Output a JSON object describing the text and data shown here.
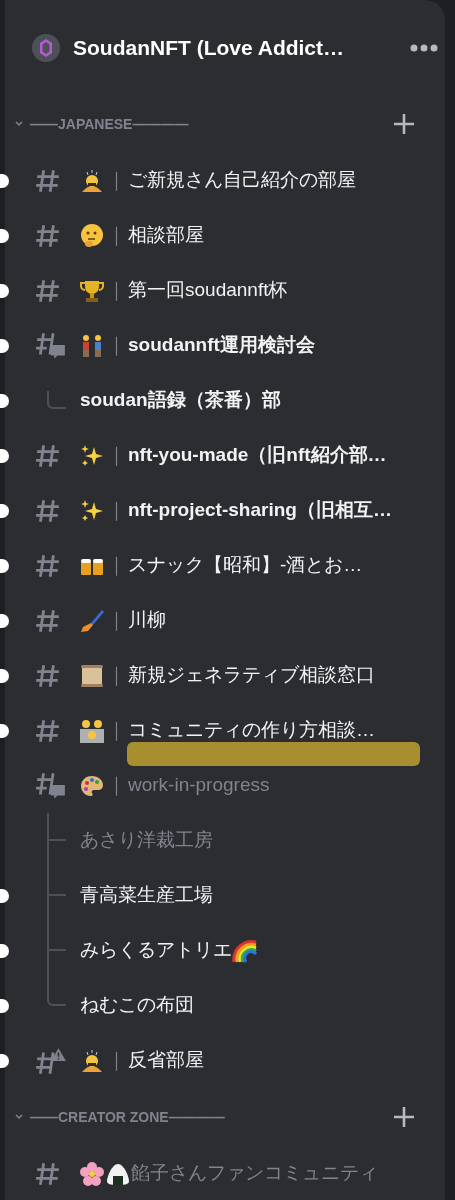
{
  "server": {
    "name": "SoudanNFT (Love Addict…"
  },
  "categories": [
    {
      "name": "——JAPANESE————",
      "expanded": true,
      "channels": [
        {
          "kind": "text",
          "emoji": [
            {
              "kind": "bowing-person"
            }
          ],
          "separator": "｜",
          "name": "ご新規さん自己紹介の部屋",
          "unread": true,
          "bold": false,
          "muted": false
        },
        {
          "kind": "text",
          "emoji": [
            {
              "kind": "thinking-face"
            }
          ],
          "separator": "｜",
          "name": "相談部屋",
          "unread": true,
          "bold": false,
          "muted": false
        },
        {
          "kind": "text",
          "emoji": [
            {
              "kind": "trophy"
            }
          ],
          "separator": "｜",
          "name": "第一回soudannft杯",
          "unread": true,
          "bold": false,
          "muted": false
        },
        {
          "kind": "forum",
          "emoji": [
            {
              "kind": "couple"
            }
          ],
          "separator": "｜",
          "name": "soudannft運用検討会",
          "unread": true,
          "bold": true,
          "muted": false,
          "children": [
            {
              "name": "soudan語録（茶番）部",
              "unread": true,
              "bold": true,
              "muted": false
            }
          ]
        },
        {
          "kind": "text",
          "emoji": [
            {
              "kind": "sparkles"
            }
          ],
          "separator": "｜",
          "name": "nft-you-made（旧nft紹介部…",
          "unread": true,
          "bold": true,
          "muted": false
        },
        {
          "kind": "text",
          "emoji": [
            {
              "kind": "sparkles"
            }
          ],
          "separator": "｜",
          "name": "nft-project-sharing（旧相互…",
          "unread": true,
          "bold": true,
          "muted": false
        },
        {
          "kind": "text",
          "emoji": [
            {
              "kind": "beer-mugs"
            }
          ],
          "separator": "｜",
          "name": "スナック【昭和】-酒とお…",
          "unread": true,
          "bold": false,
          "muted": false
        },
        {
          "kind": "text",
          "emoji": [
            {
              "kind": "paintbrush"
            }
          ],
          "separator": "｜",
          "name": "川柳",
          "unread": true,
          "bold": false,
          "muted": false
        },
        {
          "kind": "text",
          "emoji": [
            {
              "kind": "scroll"
            }
          ],
          "separator": "｜",
          "name": "新規ジェネラティブ相談窓口",
          "unread": true,
          "bold": false,
          "muted": false
        },
        {
          "kind": "text",
          "emoji": [
            {
              "kind": "family"
            }
          ],
          "separator": "｜",
          "name": "コミュニティの作り方相談…",
          "unread": true,
          "bold": false,
          "muted": false,
          "redacted": true
        },
        {
          "kind": "forum",
          "emoji": [
            {
              "kind": "palette"
            }
          ],
          "separator": "｜",
          "name": "work-in-progress",
          "unread": false,
          "bold": false,
          "muted": true,
          "children": [
            {
              "name": "あさり洋裁工房",
              "unread": false,
              "bold": false,
              "muted": true
            },
            {
              "name": "青高菜生産工場",
              "unread": true,
              "bold": false,
              "muted": false
            },
            {
              "name": "みらくるアトリエ",
              "trailing_emoji": {
                "kind": "rainbow"
              },
              "unread": true,
              "bold": false,
              "muted": false
            },
            {
              "name": "ねむこの布団",
              "unread": true,
              "bold": false,
              "muted": false
            }
          ]
        },
        {
          "kind": "warning",
          "emoji": [
            {
              "kind": "bowing-person"
            }
          ],
          "separator": "｜",
          "name": "反省部屋",
          "unread": true,
          "bold": false,
          "muted": false
        }
      ]
    },
    {
      "name": "——CREATOR ZONE————",
      "expanded": true,
      "channels": [
        {
          "kind": "text",
          "emoji": [
            {
              "kind": "flower"
            },
            {
              "kind": "rice-ball"
            }
          ],
          "name": "餡子さんファンコミュニティ",
          "unread": false,
          "bold": false,
          "muted": true
        }
      ]
    }
  ]
}
